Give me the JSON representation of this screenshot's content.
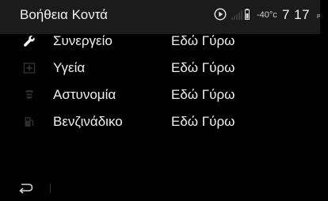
{
  "header": {
    "title": "Βοήθεια Κοντά",
    "status": {
      "temperature": "-40°c",
      "time": "7 17",
      "ampm": "P",
      "icons": [
        "play-circle-icon",
        "signal-icon",
        "battery-icon"
      ]
    }
  },
  "list": {
    "items": [
      {
        "label": "Συνεργείο",
        "value": "Εδώ Γύρω",
        "icon": "wrench-icon",
        "icon_active": true
      },
      {
        "label": "Υγεία",
        "value": "Εδώ Γύρω",
        "icon": "medical-cross-icon",
        "icon_active": false
      },
      {
        "label": "Αστυνομία",
        "value": "Εδώ Γύρω",
        "icon": "police-badge-icon",
        "icon_active": false
      },
      {
        "label": "Βενζινάδικο",
        "value": "Εδώ Γύρω",
        "icon": "fuel-pump-icon",
        "icon_active": false
      }
    ]
  },
  "footer": {
    "back_icon": "back-arrow-icon"
  },
  "colors": {
    "background": "#000000",
    "header_bg": "#1b1b1b",
    "text": "#f0f0f0",
    "icon_inactive": "#2e2e2e"
  }
}
